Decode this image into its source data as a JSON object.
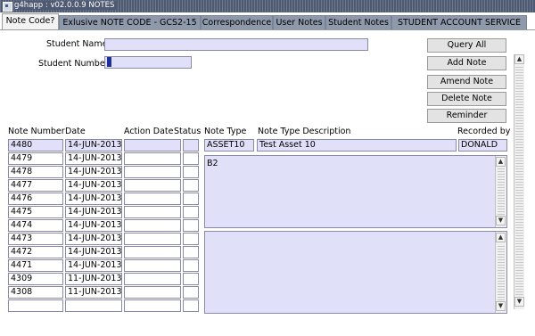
{
  "window": {
    "title": "g4happ : v02.0.0.9 NOTES"
  },
  "tabs": [
    {
      "label": "Note Code?"
    },
    {
      "label": "Exlusive NOTE CODE - GCS2-15"
    },
    {
      "label": "Correspondence"
    },
    {
      "label": "User Notes"
    },
    {
      "label": "Student Notes"
    },
    {
      "label": "STUDENT ACCOUNT SERVICE"
    }
  ],
  "form": {
    "student_name_label": "Student Name",
    "student_name_value": "",
    "student_number_label": "Student Number",
    "student_number_value": ""
  },
  "buttons": {
    "query_all": "Query All",
    "add_note": "Add Note",
    "amend_note": "Amend Note",
    "delete_note": "Delete Note",
    "reminder": "Reminder"
  },
  "table": {
    "headers": {
      "note_number": "Note Number",
      "date": "Date",
      "action_date": "Action Date",
      "status": "Status",
      "note_type": "Note Type",
      "note_type_description": "Note Type Description",
      "recorded_by": "Recorded by"
    },
    "rows": [
      {
        "note_number": "4480",
        "date": "14-JUN-2013"
      },
      {
        "note_number": "4479",
        "date": "14-JUN-2013"
      },
      {
        "note_number": "4478",
        "date": "14-JUN-2013"
      },
      {
        "note_number": "4477",
        "date": "14-JUN-2013"
      },
      {
        "note_number": "4476",
        "date": "14-JUN-2013"
      },
      {
        "note_number": "4475",
        "date": "14-JUN-2013"
      },
      {
        "note_number": "4474",
        "date": "14-JUN-2013"
      },
      {
        "note_number": "4473",
        "date": "14-JUN-2013"
      },
      {
        "note_number": "4472",
        "date": "14-JUN-2013"
      },
      {
        "note_number": "4471",
        "date": "14-JUN-2013"
      },
      {
        "note_number": "4309",
        "date": "11-JUN-2013"
      },
      {
        "note_number": "4308",
        "date": "11-JUN-2013"
      },
      {
        "note_number": "",
        "date": ""
      }
    ]
  },
  "detail": {
    "note_type": "ASSET10",
    "note_type_description": "Test Asset 10",
    "recorded_by": "DONALD",
    "note_text": "B2",
    "second_text": ""
  },
  "colors": {
    "field_bg": "#e0e0f8",
    "tab_bg": "#8e99ac",
    "titlebar_bg": "#4e5a72"
  }
}
